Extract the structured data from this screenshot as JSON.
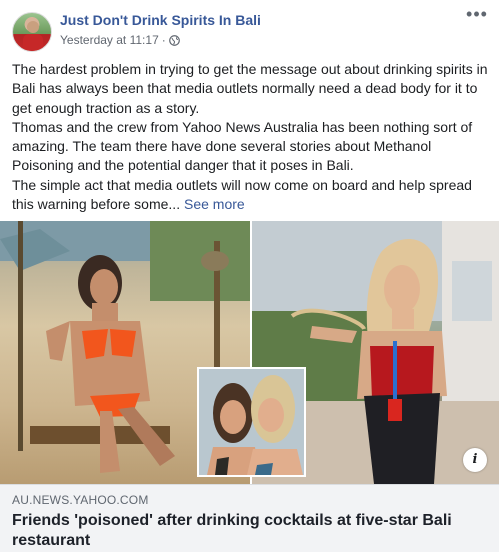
{
  "post": {
    "page_name": "Just Don't Drink Spirits In Bali",
    "timestamp": "Yesterday at 11:17",
    "separator": "·",
    "privacy_icon": "globe-icon",
    "more_icon": "more-options-icon",
    "more_label": "•••",
    "paragraphs": [
      "The hardest problem in trying to get the message out about drinking spirits in Bali has always been that media outlets normally need a dead body for it to get enough traction as a story.",
      "Thomas and the crew from Yahoo News Australia has been nothing sort of amazing. The team there have done several stories about Methanol Poisoning and the potential danger that it poses in Bali.",
      "The simple act that media outlets will now come on board and help spread this warning before some..."
    ],
    "see_more_label": "See more"
  },
  "link_card": {
    "domain": "AU.NEWS.YAHOO.COM",
    "title": "Friends 'poisoned' after drinking cocktails at five-star Bali restaurant",
    "info_label": "i"
  }
}
